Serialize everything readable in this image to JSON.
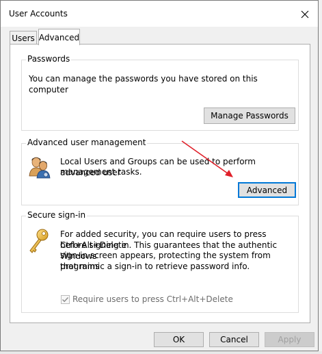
{
  "window": {
    "title": "User Accounts"
  },
  "tabs": [
    {
      "label": "Users"
    },
    {
      "label": "Advanced"
    }
  ],
  "passwords": {
    "title": "Passwords",
    "description": "You can manage the passwords you have stored on this computer",
    "button": "Manage Passwords"
  },
  "advanced_mgmt": {
    "title": "Advanced user management",
    "line1": "Local Users and Groups can be used to perform advanced user",
    "line2": "management tasks.",
    "button": "Advanced",
    "icon": "users-icon"
  },
  "secure_signin": {
    "title": "Secure sign-in",
    "lines": [
      "For added security, you can require users to press Ctrl+Alt+Delete",
      "before signing in. This guarantees that the authentic Windows",
      "sign-in screen appears, protecting the system from programs",
      "that mimic a sign-in to retrieve password info."
    ],
    "checkbox_label": "Require users to press Ctrl+Alt+Delete",
    "checkbox_checked": true,
    "icon": "key-icon"
  },
  "footer": {
    "ok": "OK",
    "cancel": "Cancel",
    "apply": "Apply"
  },
  "colors": {
    "arrow": "#e0202a",
    "focus": "#0078d7"
  }
}
